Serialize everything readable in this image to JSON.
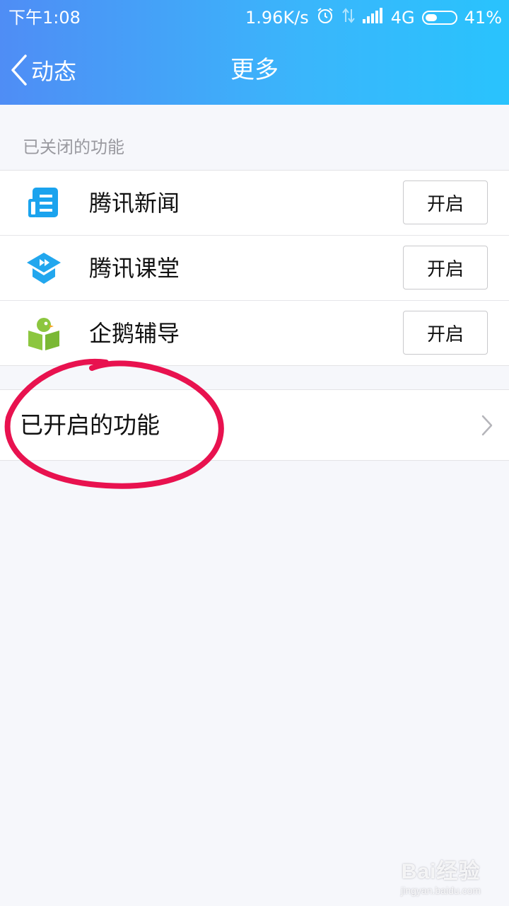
{
  "status_bar": {
    "time": "下午1:08",
    "network_speed": "1.96K/s",
    "network_type": "4G",
    "battery_percent": "41%",
    "battery_level": 0.41,
    "icons": [
      "alarm-icon",
      "data-transfer-icon",
      "signal-icon",
      "battery-icon"
    ]
  },
  "nav": {
    "back_label": "动态",
    "title": "更多"
  },
  "closed_section": {
    "header": "已关闭的功能",
    "items": [
      {
        "label": "腾讯新闻",
        "button": "开启",
        "icon": "tencent-news-icon",
        "color": "#1aa3ee"
      },
      {
        "label": "腾讯课堂",
        "button": "开启",
        "icon": "tencent-classroom-icon",
        "color": "#22a7ee"
      },
      {
        "label": "企鹅辅导",
        "button": "开启",
        "icon": "penguin-tutor-icon",
        "color": "#8cc63f"
      }
    ]
  },
  "enabled_section": {
    "label": "已开启的功能"
  },
  "annotation": {
    "color": "#e8124f"
  },
  "watermark": {
    "logo": "Bai经验",
    "url": "jingyan.baidu.com"
  }
}
